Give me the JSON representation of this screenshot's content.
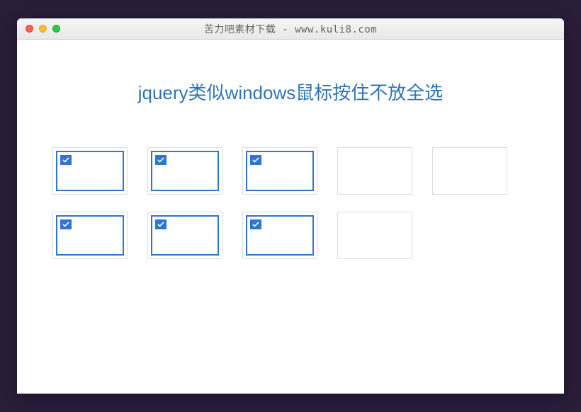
{
  "window": {
    "title": "苦力吧素材下载 - www.kuli8.com"
  },
  "page": {
    "heading": "jquery类似windows鼠标按住不放全选"
  },
  "items": [
    {
      "selected": true
    },
    {
      "selected": true
    },
    {
      "selected": true
    },
    {
      "selected": false
    },
    {
      "selected": false
    },
    {
      "selected": true
    },
    {
      "selected": true
    },
    {
      "selected": true
    },
    {
      "selected": false
    }
  ]
}
